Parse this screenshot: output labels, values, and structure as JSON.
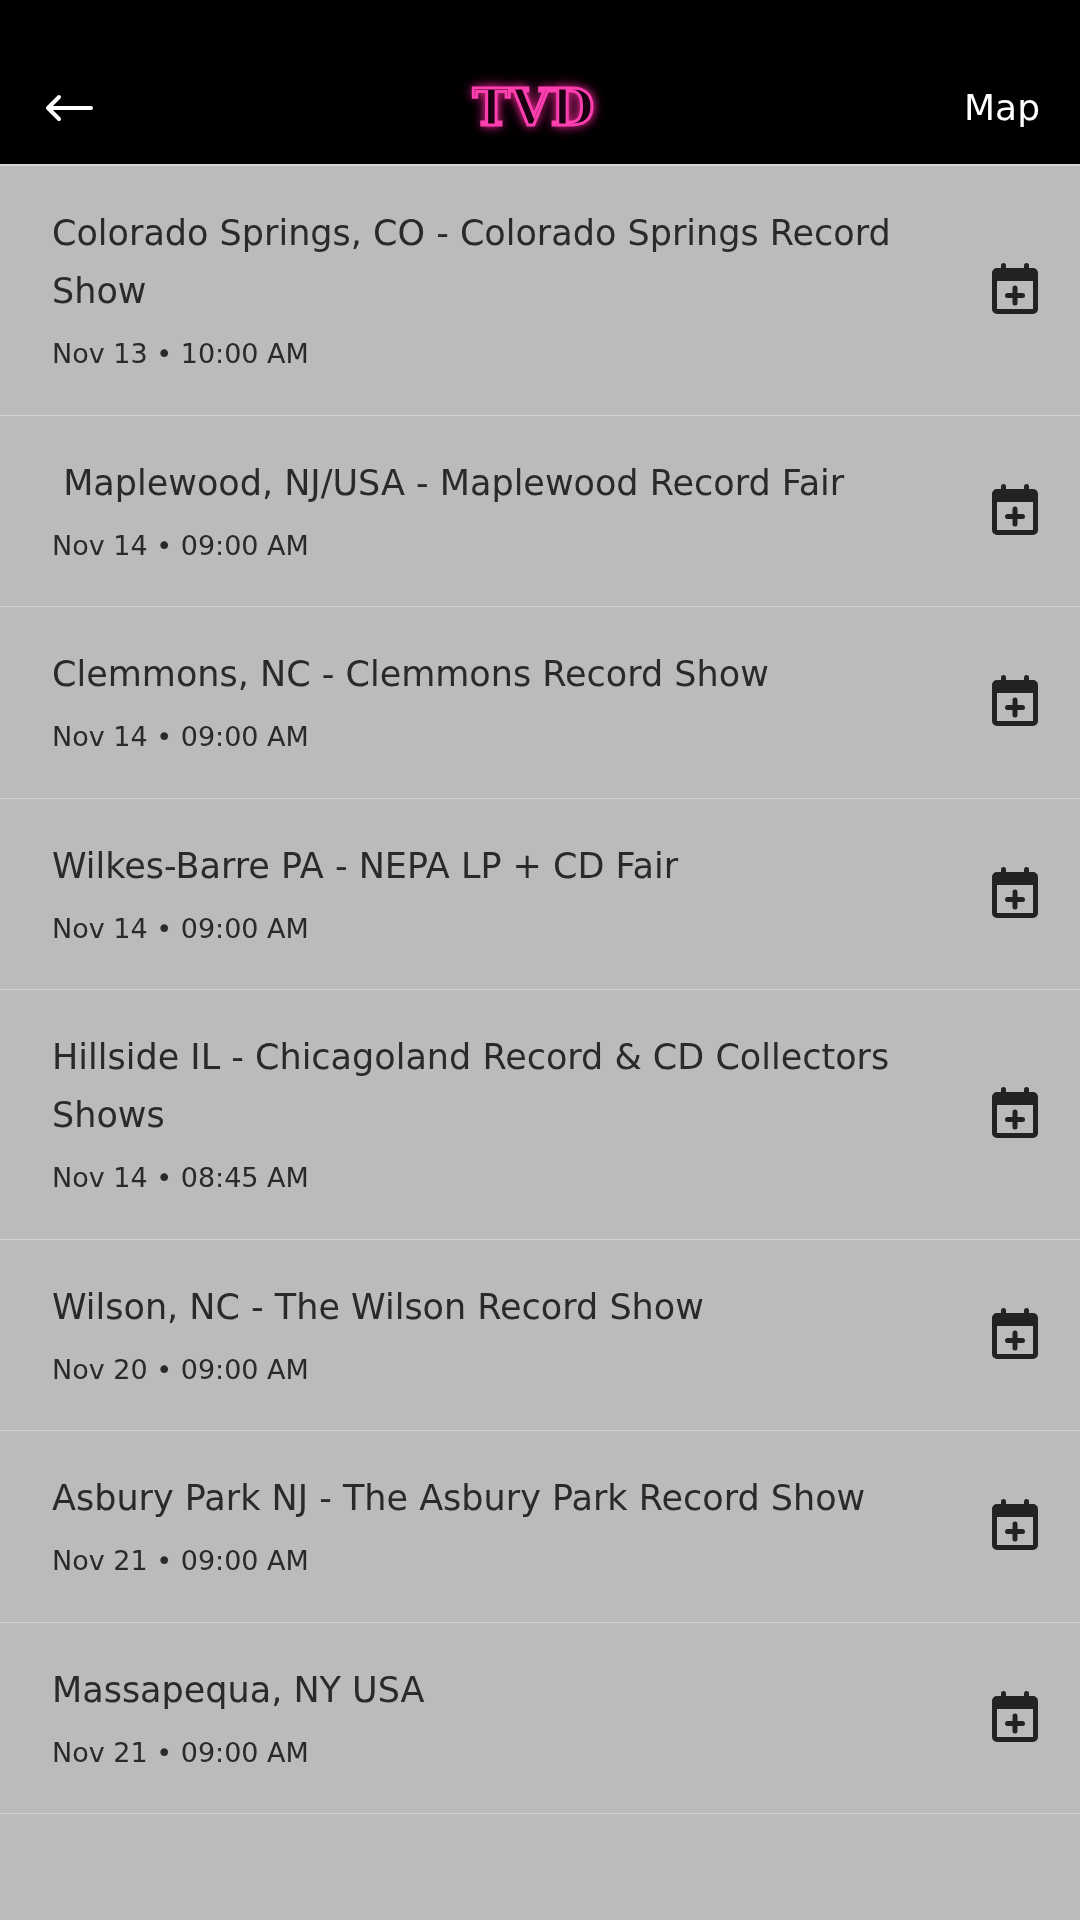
{
  "header": {
    "logo": "TVD",
    "action": "Map"
  },
  "events": [
    {
      "title": "Colorado Springs, CO - Colorado Springs Record Show",
      "when": "Nov 13 • 10:00 AM"
    },
    {
      "title": " Maplewood, NJ/USA - Maplewood Record Fair",
      "when": "Nov 14 • 09:00 AM"
    },
    {
      "title": "Clemmons, NC - Clemmons Record Show",
      "when": "Nov 14 • 09:00 AM"
    },
    {
      "title": "Wilkes-Barre PA - NEPA LP + CD Fair",
      "when": "Nov 14 • 09:00 AM"
    },
    {
      "title": "Hillside IL - Chicagoland Record & CD Collectors Shows",
      "when": "Nov 14 • 08:45 AM"
    },
    {
      "title": "Wilson, NC - The Wilson Record Show",
      "when": "Nov 20 • 09:00 AM"
    },
    {
      "title": "Asbury Park NJ - The Asbury Park Record Show",
      "when": "Nov 21 • 09:00 AM"
    },
    {
      "title": "Massapequa, NY USA",
      "when": "Nov 21 • 09:00 AM"
    }
  ]
}
